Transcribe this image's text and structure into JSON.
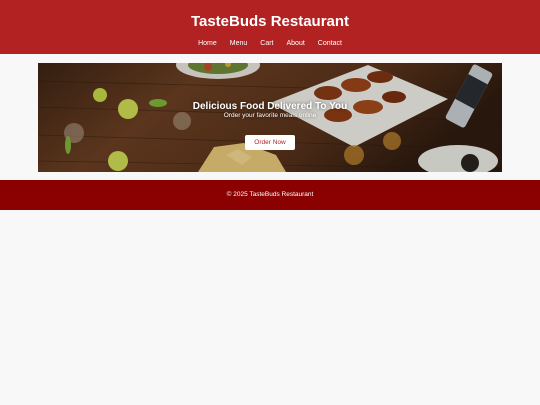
{
  "header": {
    "title": "TasteBuds Restaurant",
    "nav": [
      "Home",
      "Menu",
      "Cart",
      "About",
      "Contact"
    ]
  },
  "hero": {
    "title": "Delicious Food Delivered To You",
    "subtitle": "Order your favorite meals online",
    "button_label": "Order Now"
  },
  "footer": {
    "copyright": "© 2025 TasteBuds Restaurant"
  },
  "colors": {
    "header_bg": "#b22222",
    "footer_bg": "#8b0000",
    "page_bg": "#f8f8f8",
    "button_text": "#b22222"
  }
}
